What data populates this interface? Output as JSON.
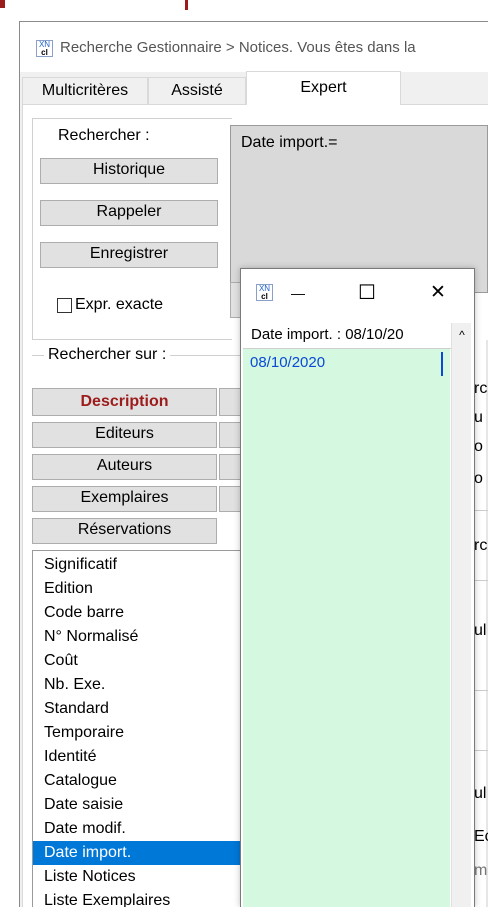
{
  "window": {
    "title": "Recherche Gestionnaire > Notices.  Vous êtes dans la"
  },
  "tabs": [
    {
      "label": "Multicritères"
    },
    {
      "label": "Assisté"
    },
    {
      "label": "Expert"
    }
  ],
  "search": {
    "label": "Rechercher :",
    "query": "Date import.=",
    "historique": "Historique",
    "rappeler": "Rappeler",
    "enregistrer": "Enregistrer",
    "expr_exacte": "Expr. exacte"
  },
  "search_on": {
    "label": "Rechercher sur :",
    "buttons": [
      "Description",
      "Editeurs",
      "Auteurs",
      "Exemplaires",
      "Réservations"
    ]
  },
  "fields": [
    {
      "label": "Significatif"
    },
    {
      "label": "Edition"
    },
    {
      "label": "Code barre"
    },
    {
      "label": "N° Normalisé"
    },
    {
      "label": "Coût"
    },
    {
      "label": "Nb. Exe."
    },
    {
      "label": "Standard"
    },
    {
      "label": "Temporaire"
    },
    {
      "label": "Identité"
    },
    {
      "label": "Catalogue"
    },
    {
      "label": "Date saisie"
    },
    {
      "label": "Date modif."
    },
    {
      "label": "Date import."
    },
    {
      "label": "Liste Notices"
    },
    {
      "label": "Liste Exemplaires"
    }
  ],
  "popup": {
    "header": "Date import.  : 08/10/20",
    "values": [
      "08/10/2020"
    ],
    "minimize": "—",
    "maximize": "☐",
    "close": "✕"
  },
  "right_fragments": [
    "rc",
    "u",
    "o",
    "o",
    "rc",
    "ul",
    "ul",
    "Ec",
    "m"
  ],
  "colors": {
    "accent_red": "#9c1b1b",
    "selection": "#0078d7",
    "popup_list": "#d4f8e0",
    "link_blue": "#0a49d8"
  }
}
